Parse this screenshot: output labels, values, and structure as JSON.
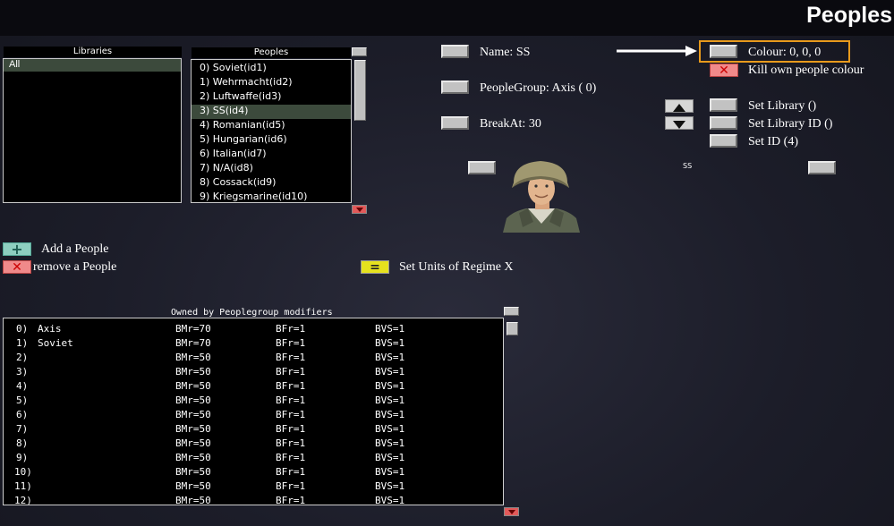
{
  "page": {
    "title": "Peoples"
  },
  "libraries": {
    "header": "Libraries",
    "items": [
      {
        "label": "All",
        "selected": true
      }
    ]
  },
  "peoples": {
    "header": "Peoples",
    "items": [
      {
        "label": "0) Soviet(id1)",
        "selected": false
      },
      {
        "label": "1) Wehrmacht(id2)",
        "selected": false
      },
      {
        "label": "2) Luftwaffe(id3)",
        "selected": false
      },
      {
        "label": "3) SS(id4)",
        "selected": true
      },
      {
        "label": "4) Romanian(id5)",
        "selected": false
      },
      {
        "label": "5) Hungarian(id6)",
        "selected": false
      },
      {
        "label": "6) Italian(id7)",
        "selected": false
      },
      {
        "label": "7) N/A(id8)",
        "selected": false
      },
      {
        "label": "8) Cossack(id9)",
        "selected": false
      },
      {
        "label": "9) Kriegsmarine(id10)",
        "selected": false
      }
    ]
  },
  "properties": {
    "name": "Name: SS",
    "people_group": "PeopleGroup: Axis ( 0)",
    "break_at": "BreakAt:  30",
    "colour": "Colour:  0, 0, 0",
    "kill_colour": "Kill own people colour",
    "set_library": "Set Library ()",
    "set_library_id": "Set Library ID ()",
    "set_id": "Set ID (4)",
    "graphic_label": "SS"
  },
  "actions": {
    "add_people": "Add a People",
    "remove_people": "remove a People",
    "set_units": "Set Units of Regime X"
  },
  "modifiers": {
    "title": "Owned by Peoplegroup modifiers",
    "rows": [
      {
        "index": "0)",
        "name": "Axis",
        "bmr": "BMr=70",
        "bfr": "BFr=1",
        "bvs": "BVS=1"
      },
      {
        "index": "1)",
        "name": "Soviet",
        "bmr": "BMr=70",
        "bfr": "BFr=1",
        "bvs": "BVS=1"
      },
      {
        "index": "2)",
        "name": "",
        "bmr": "BMr=50",
        "bfr": "BFr=1",
        "bvs": "BVS=1"
      },
      {
        "index": "3)",
        "name": "",
        "bmr": "BMr=50",
        "bfr": "BFr=1",
        "bvs": "BVS=1"
      },
      {
        "index": "4)",
        "name": "",
        "bmr": "BMr=50",
        "bfr": "BFr=1",
        "bvs": "BVS=1"
      },
      {
        "index": "5)",
        "name": "",
        "bmr": "BMr=50",
        "bfr": "BFr=1",
        "bvs": "BVS=1"
      },
      {
        "index": "6)",
        "name": "",
        "bmr": "BMr=50",
        "bfr": "BFr=1",
        "bvs": "BVS=1"
      },
      {
        "index": "7)",
        "name": "",
        "bmr": "BMr=50",
        "bfr": "BFr=1",
        "bvs": "BVS=1"
      },
      {
        "index": "8)",
        "name": "",
        "bmr": "BMr=50",
        "bfr": "BFr=1",
        "bvs": "BVS=1"
      },
      {
        "index": "9)",
        "name": "",
        "bmr": "BMr=50",
        "bfr": "BFr=1",
        "bvs": "BVS=1"
      },
      {
        "index": "10)",
        "name": "",
        "bmr": "BMr=50",
        "bfr": "BFr=1",
        "bvs": "BVS=1"
      },
      {
        "index": "11)",
        "name": "",
        "bmr": "BMr=50",
        "bfr": "BFr=1",
        "bvs": "BVS=1"
      },
      {
        "index": "12)",
        "name": "",
        "bmr": "BMr=50",
        "bfr": "BFr=1",
        "bvs": "BVS=1"
      }
    ]
  },
  "icons": {
    "add": "plus-icon",
    "remove": "x-icon",
    "set_units": "equals-icon",
    "up": "arrow-up-icon",
    "down": "arrow-down-icon",
    "pointer": "arrow-right-icon",
    "portrait": "soldier-portrait"
  },
  "colors": {
    "selection": "#3c4a3c",
    "highlight": "#e89a1c"
  }
}
